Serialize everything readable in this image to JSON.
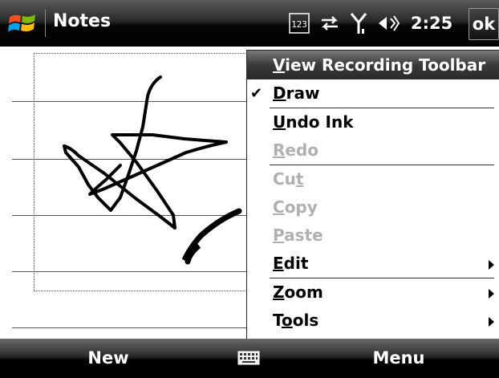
{
  "titlebar": {
    "app_title": "Notes",
    "input_mode": "123",
    "clock": "2:25",
    "ok_label": "ok"
  },
  "menu": {
    "header": {
      "prefix": "",
      "accel": "V",
      "rest": "iew Recording Toolbar"
    },
    "items": [
      {
        "before": "",
        "accel": "D",
        "after": "raw",
        "checked": true,
        "disabled": false,
        "submenu": false
      },
      {
        "before": "",
        "accel": "U",
        "after": "ndo Ink",
        "checked": false,
        "disabled": false,
        "submenu": false
      },
      {
        "before": "",
        "accel": "R",
        "after": "edo",
        "checked": false,
        "disabled": true,
        "submenu": false
      },
      {
        "before": "Cu",
        "accel": "t",
        "after": "",
        "checked": false,
        "disabled": true,
        "submenu": false
      },
      {
        "before": "",
        "accel": "C",
        "after": "opy",
        "checked": false,
        "disabled": true,
        "submenu": false
      },
      {
        "before": "",
        "accel": "P",
        "after": "aste",
        "checked": false,
        "disabled": true,
        "submenu": false
      },
      {
        "before": "",
        "accel": "E",
        "after": "dit",
        "checked": false,
        "disabled": false,
        "submenu": true
      },
      {
        "before": "",
        "accel": "Z",
        "after": "oom",
        "checked": false,
        "disabled": false,
        "submenu": true
      },
      {
        "before": "T",
        "accel": "o",
        "after": "ols",
        "checked": false,
        "disabled": false,
        "submenu": true
      }
    ]
  },
  "softkeys": {
    "left": "New",
    "right": "Menu"
  },
  "colors": {
    "bar_dark": "#000000",
    "disabled_text": "#b0b0b0"
  },
  "icons": [
    "windows-start-icon",
    "input-mode-icon",
    "connectivity-icon",
    "signal-icon",
    "volume-icon",
    "keyboard-icon"
  ]
}
